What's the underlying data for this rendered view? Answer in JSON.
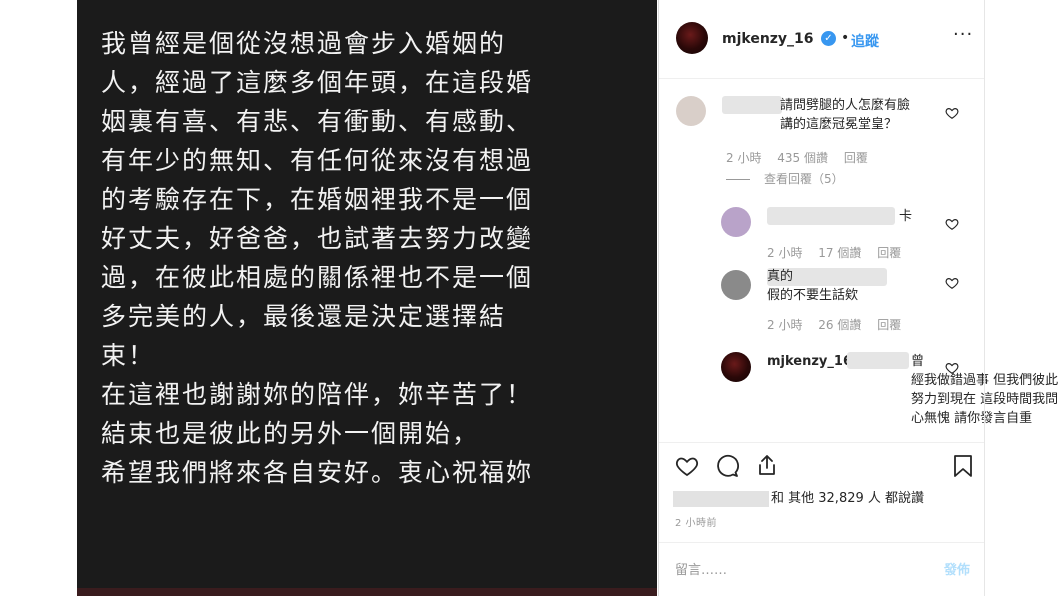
{
  "post": {
    "lines": [
      "我曾經是個從沒想過會步入婚姻的",
      "人，經過了這麼多個年頭，在這段婚",
      "姻裏有喜、有悲、有衝動、有感動、",
      "有年少的無知、有任何從來沒有想過",
      "的考驗存在下，在婚姻裡我不是一個",
      "好丈夫，好爸爸，也試著去努力改變",
      "過，在彼此相處的關係裡也不是一個",
      "多完美的人，最後還是決定選擇結",
      "束！",
      "在這裡也謝謝妳的陪伴，妳辛苦了！",
      "結束也是彼此的另外一個開始，",
      "希望我們將來各自安好。衷心祝福妳"
    ]
  },
  "header": {
    "username": "mjkenzy_16",
    "separator": "•",
    "follow_label": "追蹤",
    "more_label": "···"
  },
  "comments": [
    {
      "text": "請問劈腿的人怎麼有臉\n講的這麼冠冕堂皇？",
      "time": "2 小時",
      "likes": "435 個讚",
      "reply": "回覆",
      "view_replies": "查看回覆（5）"
    },
    {
      "text": "卡",
      "time": "2 小時",
      "likes": "17 個讚",
      "reply": "回覆"
    },
    {
      "text": "真的\n假的不要生話欸",
      "time": "2 小時",
      "likes": "26 個讚",
      "reply": "回覆"
    },
    {
      "username": "mjkenzy_16",
      "text": "曾\n經我做錯過事 但我們彼此\n努力到現在 這段時間我問\n心無愧 請你發言自重"
    }
  ],
  "likes": {
    "text": "和 其他 32,829 人 都說讚"
  },
  "time_ago": "2 小時前",
  "comment_box": {
    "placeholder": "留言……",
    "post_label": "發佈"
  },
  "colors": {
    "accent": "#3897f0",
    "image_bg": "#1b1b1b",
    "muted": "#999999"
  },
  "icons": [
    "heart-icon",
    "comment-icon",
    "share-icon",
    "bookmark-icon",
    "verified-badge-icon"
  ]
}
